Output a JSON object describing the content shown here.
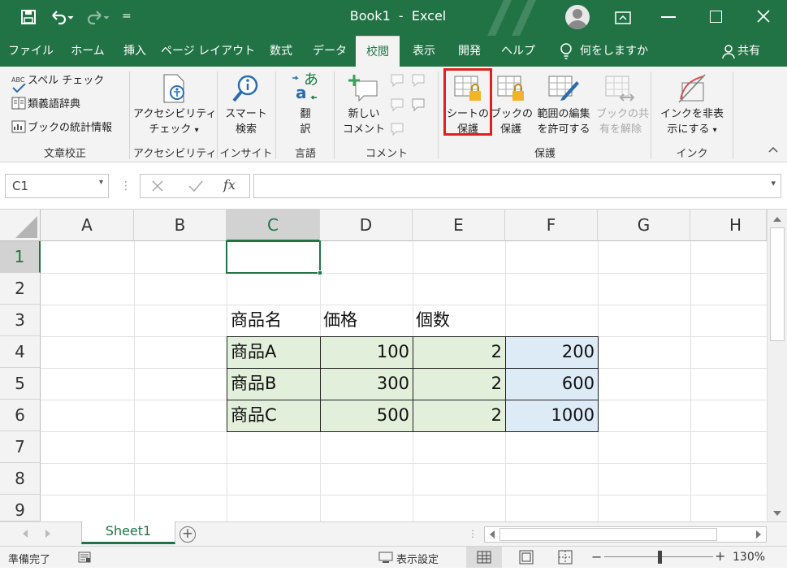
{
  "titlebar": {
    "title": "Book1  -  Excel",
    "qat_more": "="
  },
  "tabs": [
    {
      "label": "ファイル",
      "active": false
    },
    {
      "label": "ホーム",
      "active": false
    },
    {
      "label": "挿入",
      "active": false
    },
    {
      "label": "ページ レイアウト",
      "active": false
    },
    {
      "label": "数式",
      "active": false
    },
    {
      "label": "データ",
      "active": false
    },
    {
      "label": "校閲",
      "active": true
    },
    {
      "label": "表示",
      "active": false
    },
    {
      "label": "開発",
      "active": false
    },
    {
      "label": "ヘルプ",
      "active": false
    }
  ],
  "tellme": "何をしますか",
  "share": "共有",
  "ribbon": {
    "proofing": {
      "spelling": "スペル チェック",
      "spelling_badge": "ABC",
      "thesaurus": "類義語辞典",
      "stats": "ブックの統計情報",
      "label": "文章校正"
    },
    "accessibility": {
      "btn1": "アクセシビリティ",
      "btn2": "チェック",
      "arrow": "▾",
      "label": "アクセシビリティ"
    },
    "insights": {
      "btn1": "スマート",
      "btn2": "検索",
      "label": "インサイト"
    },
    "language": {
      "btn1": "翻",
      "btn2": "訳",
      "glyph_a": "あ",
      "glyph_b": "a",
      "label": "言語"
    },
    "comments": {
      "btn1": "新しい",
      "btn2": "コメント",
      "label": "コメント"
    },
    "protect": {
      "sheet1": "シートの",
      "sheet2": "保護",
      "book1": "ブックの",
      "book2": "保護",
      "range1": "範囲の編集",
      "range2": "を許可する",
      "share1": "ブックの共",
      "share2": "有を解除",
      "label": "保護"
    },
    "ink": {
      "btn1": "インクを非表",
      "btn2": "示にする",
      "arrow": "▾",
      "label": "インク"
    }
  },
  "formula_bar": {
    "name_box": "C1",
    "fx": "fx",
    "content": ""
  },
  "columns": [
    "A",
    "B",
    "C",
    "D",
    "E",
    "F",
    "G",
    "H"
  ],
  "rows": [
    "1",
    "2",
    "3",
    "4",
    "5",
    "6",
    "7",
    "8",
    "9"
  ],
  "cells": {
    "c3": "商品名",
    "d3": "価格",
    "e3": "個数",
    "c4": "商品A",
    "d4": "100",
    "e4": "2",
    "f4": "200",
    "c5": "商品B",
    "d5": "300",
    "e5": "2",
    "f5": "600",
    "c6": "商品C",
    "d6": "500",
    "e6": "2",
    "f6": "1000"
  },
  "sheets": [
    {
      "label": "Sheet1",
      "active": true
    }
  ],
  "status": {
    "ready": "準備完了",
    "display_settings": "表示設定",
    "zoom_minus": "−",
    "zoom_plus": "+",
    "zoom": "130%"
  },
  "colors": {
    "brand": "#217346",
    "highlight_box": "#e02020",
    "cell_green": "#e2efda",
    "cell_blue": "#ddebf7"
  }
}
